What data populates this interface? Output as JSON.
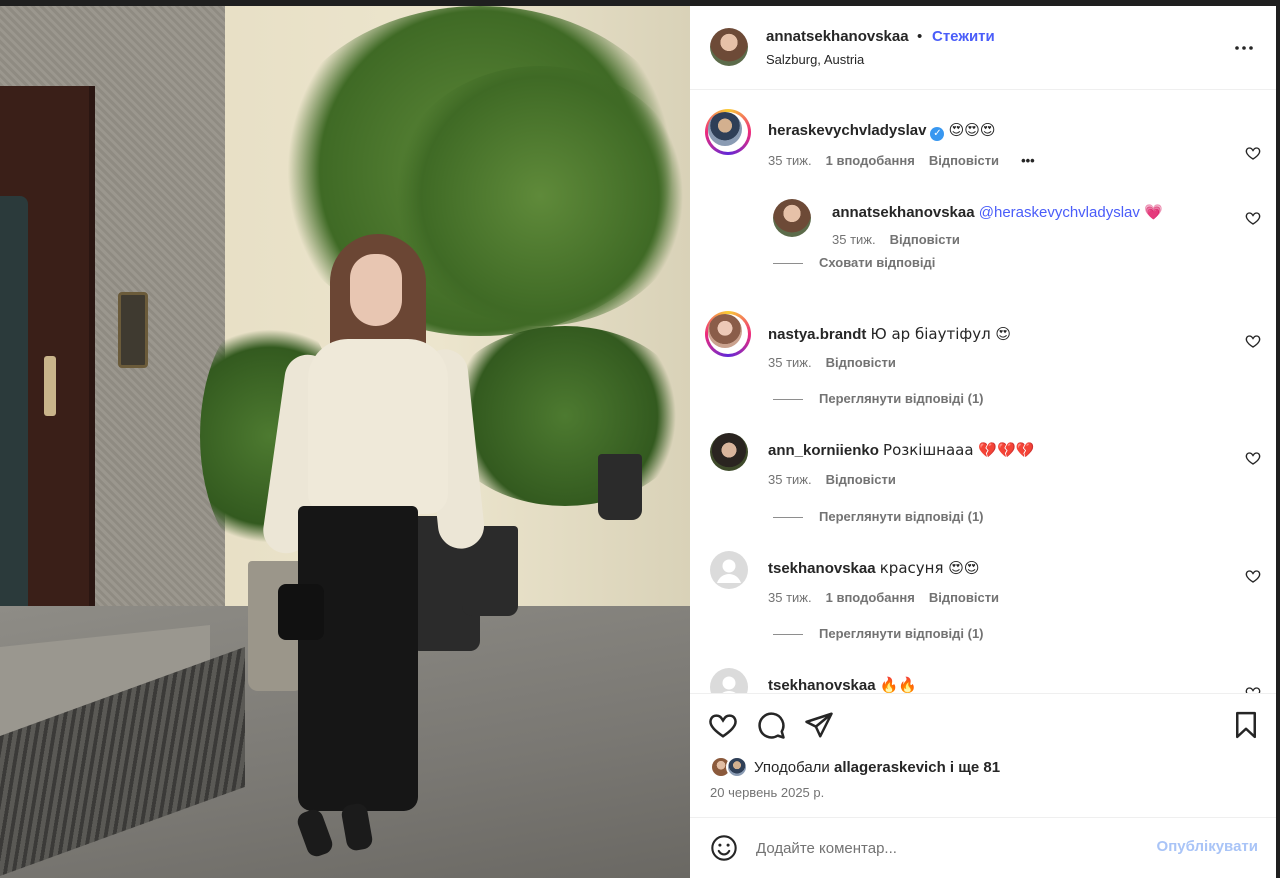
{
  "post": {
    "author": "annatsekhanovskaa",
    "separator": "•",
    "follow_label": "Стежити",
    "location": "Salzburg, Austria",
    "more_icon": "more-horizontal-icon"
  },
  "comments": [
    {
      "username": "heraskevychvladyslav",
      "verified": true,
      "text": "😍😍😍",
      "age": "35 тиж.",
      "likes": "1 вподобання",
      "reply_label": "Відповісти",
      "options": "•••"
    },
    {
      "username": "annatsekhanovskaa",
      "mention": "@heraskevychvladyslav",
      "text": "💗",
      "age": "35 тиж.",
      "reply_label": "Відповісти"
    },
    {
      "username": "nastya.brandt",
      "text": "Ю ар біаутіфул 😍",
      "age": "35 тиж.",
      "reply_label": "Відповісти",
      "thread_label": "Переглянути відповіді (1)"
    },
    {
      "username": "ann_korniienko",
      "text": "Розкішнааа 💔💔💔",
      "age": "35 тиж.",
      "reply_label": "Відповісти",
      "thread_label": "Переглянути відповіді (1)"
    },
    {
      "username": "tsekhanovskaa",
      "text": "красуня 😍😍",
      "age": "35 тиж.",
      "likes": "1 вподобання",
      "reply_label": "Відповісти",
      "thread_label": "Переглянути відповіді (1)"
    },
    {
      "username": "tsekhanovskaa",
      "text": "🔥🔥"
    }
  ],
  "hide_replies_label": "Сховати відповіді",
  "likes": {
    "prefix": "Уподобали",
    "user": "allageraskevich",
    "suffix": "і ще 81"
  },
  "date": "20 червень 2025 р.",
  "composer": {
    "placeholder": "Додайте коментар...",
    "post_label": "Опублікувати"
  },
  "colors": {
    "link_blue": "#4a5df9",
    "post_disabled": "#a9c4f7",
    "muted": "#737373"
  }
}
